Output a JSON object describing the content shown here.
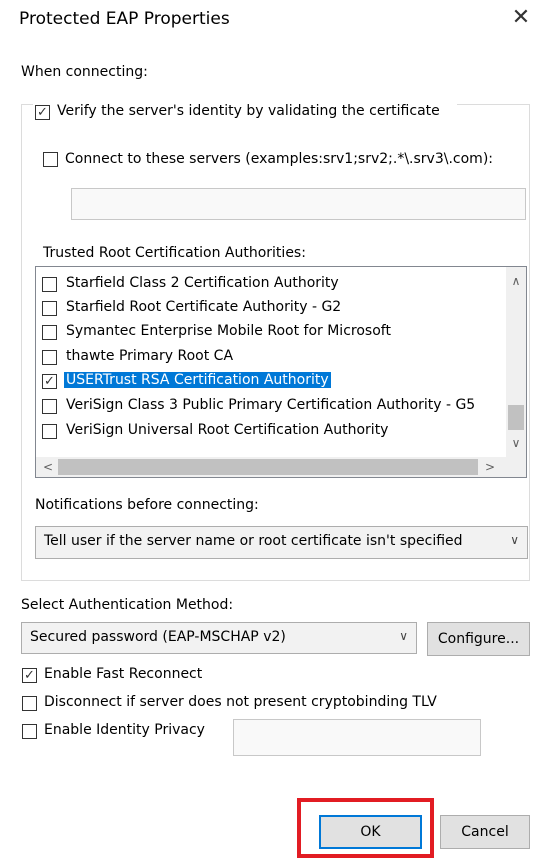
{
  "window": {
    "title": "Protected EAP Properties",
    "close_glyph": "✕"
  },
  "connecting": {
    "legend": "When connecting:",
    "verify_label": "Verify the server's identity by validating the certificate",
    "verify_checked": true,
    "connect_servers_label": "Connect to these servers (examples:srv1;srv2;.*\\.srv3\\.com):",
    "connect_servers_checked": false,
    "servers_value": "",
    "trusted_root_label": "Trusted Root Certification Authorities:",
    "cert_list": [
      {
        "label": "Starfield Class 2 Certification Authority",
        "checked": false,
        "selected": false
      },
      {
        "label": "Starfield Root Certificate Authority - G2",
        "checked": false,
        "selected": false
      },
      {
        "label": "Symantec Enterprise Mobile Root for Microsoft",
        "checked": false,
        "selected": false
      },
      {
        "label": "thawte Primary Root CA",
        "checked": false,
        "selected": false
      },
      {
        "label": "USERTrust RSA Certification Authority",
        "checked": true,
        "selected": true
      },
      {
        "label": "VeriSign Class 3 Public Primary Certification Authority - G5",
        "checked": false,
        "selected": false
      },
      {
        "label": "VeriSign Universal Root Certification Authority",
        "checked": false,
        "selected": false
      }
    ],
    "notifications_label": "Notifications before connecting:",
    "notifications_value": "Tell user if the server name or root certificate isn't specified"
  },
  "auth": {
    "label": "Select Authentication Method:",
    "method_value": "Secured password (EAP-MSCHAP v2)",
    "configure_label": "Configure..."
  },
  "options": {
    "fast_reconnect_label": "Enable Fast Reconnect",
    "fast_reconnect_checked": true,
    "cryptobinding_label": "Disconnect if server does not present cryptobinding TLV",
    "cryptobinding_checked": false,
    "identity_privacy_label": "Enable Identity Privacy",
    "identity_privacy_checked": false,
    "identity_value": ""
  },
  "buttons": {
    "ok_label": "OK",
    "cancel_label": "Cancel"
  },
  "icons": {
    "check": "✓",
    "chevron_down": "∨",
    "scroll_up": "∧",
    "scroll_down": "∨",
    "scroll_left": "<",
    "scroll_right": ">"
  },
  "colors": {
    "selection": "#0078d7",
    "highlight_box": "#e21c23"
  }
}
